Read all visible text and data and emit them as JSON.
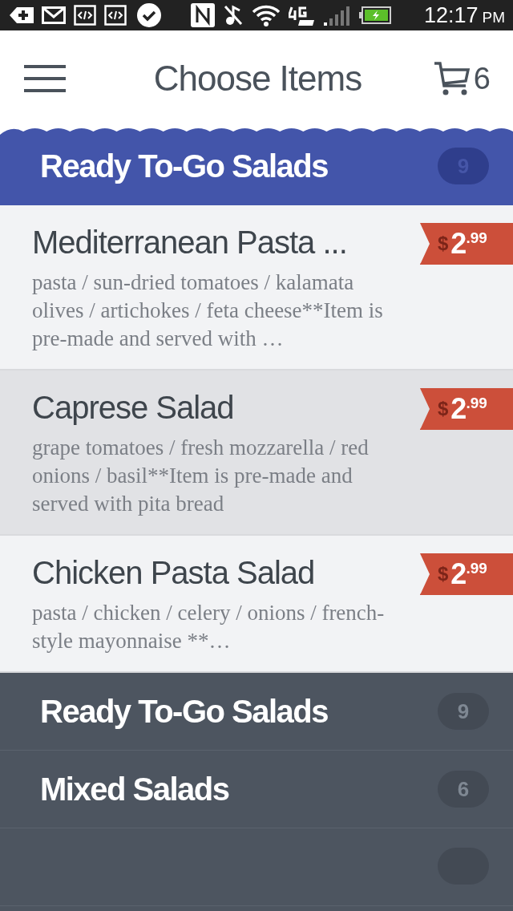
{
  "status_bar": {
    "time": "12:17",
    "meridiem": "PM"
  },
  "header": {
    "title": "Choose Items",
    "cart_count": "6"
  },
  "active_category": {
    "name": "Ready To-Go Salads",
    "count": "9"
  },
  "items": [
    {
      "name": "Mediterranean Pasta ...",
      "description": "pasta / sun-dried tomatoes / kalamata olives / artichokes / feta cheese**Item is pre-made and served with …",
      "currency": "$",
      "price_whole": "2",
      "price_cents": ".99",
      "selected": false
    },
    {
      "name": "Caprese Salad",
      "description": "grape tomatoes / fresh mozzarella / red onions / basil**Item is pre-made and served with pita bread",
      "currency": "$",
      "price_whole": "2",
      "price_cents": ".99",
      "selected": true
    },
    {
      "name": "Chicken Pasta Salad",
      "description": "pasta / chicken / celery / onions / french-style mayonnaise **…",
      "currency": "$",
      "price_whole": "2",
      "price_cents": ".99",
      "selected": false
    }
  ],
  "categories": [
    {
      "name": "Ready To-Go Salads",
      "count": "9"
    },
    {
      "name": "Mixed Salads",
      "count": "6"
    }
  ]
}
